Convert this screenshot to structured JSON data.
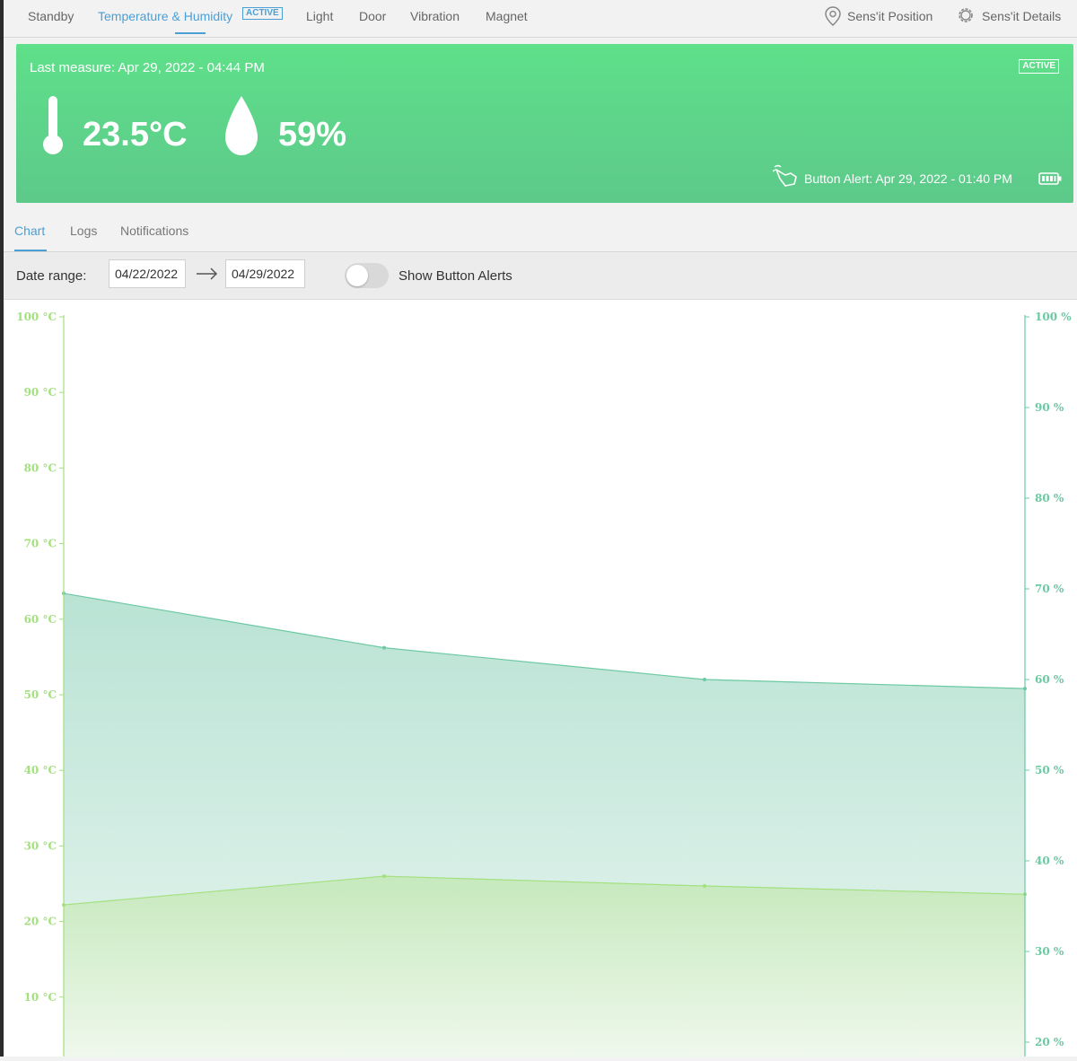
{
  "tabs": [
    {
      "label": "Standby"
    },
    {
      "label": "Temperature & Humidity",
      "badge": "ACTIVE"
    },
    {
      "label": "Light"
    },
    {
      "label": "Door"
    },
    {
      "label": "Vibration"
    },
    {
      "label": "Magnet"
    }
  ],
  "links": {
    "position": "Sens'it Position",
    "details": "Sens'it Details"
  },
  "card": {
    "last_measure": "Last measure: Apr 29, 2022 - 04:44 PM",
    "status": "ACTIVE",
    "temperature": "23.5°C",
    "humidity": "59%",
    "button_alert": "Button Alert: Apr 29, 2022 - 01:40 PM"
  },
  "subtabs": [
    {
      "label": "Chart"
    },
    {
      "label": "Logs"
    },
    {
      "label": "Notifications"
    }
  ],
  "filter": {
    "date_range_label": "Date range:",
    "start_date": "04/22/2022",
    "end_date": "04/29/2022",
    "show_alerts_label": "Show Button Alerts",
    "show_alerts_on": false
  },
  "colors": {
    "accent": "#4b9fd5",
    "card_green": "#5fe08a",
    "temp_series": "#a3e07e",
    "humidity_series": "#6cc9a3"
  },
  "icons": [
    "map-pin-icon",
    "gear-icon",
    "thermometer-icon",
    "water-drop-icon",
    "hand-pointer-icon",
    "battery-icon",
    "arrow-right-icon"
  ],
  "chart_data": {
    "type": "area",
    "x": [
      1,
      2,
      3,
      4
    ],
    "series": [
      {
        "axis": "left",
        "values": [
          22.2,
          26,
          24.7,
          23.6
        ]
      },
      {
        "axis": "right",
        "values": [
          69.5,
          63.5,
          60,
          59
        ]
      }
    ],
    "left_axis": {
      "ticks": [
        "100 °C",
        "90 °C",
        "80 °C",
        "70 °C",
        "60 °C",
        "50 °C",
        "40 °C",
        "30 °C",
        "20 °C",
        "10 °C"
      ],
      "range": [
        0,
        100
      ]
    },
    "right_axis": {
      "ticks": [
        "100 %",
        "90 %",
        "80 %",
        "70 %",
        "60 %",
        "50 %",
        "40 %",
        "30 %",
        "20 %"
      ],
      "range": [
        20,
        100
      ]
    },
    "grid": false
  }
}
